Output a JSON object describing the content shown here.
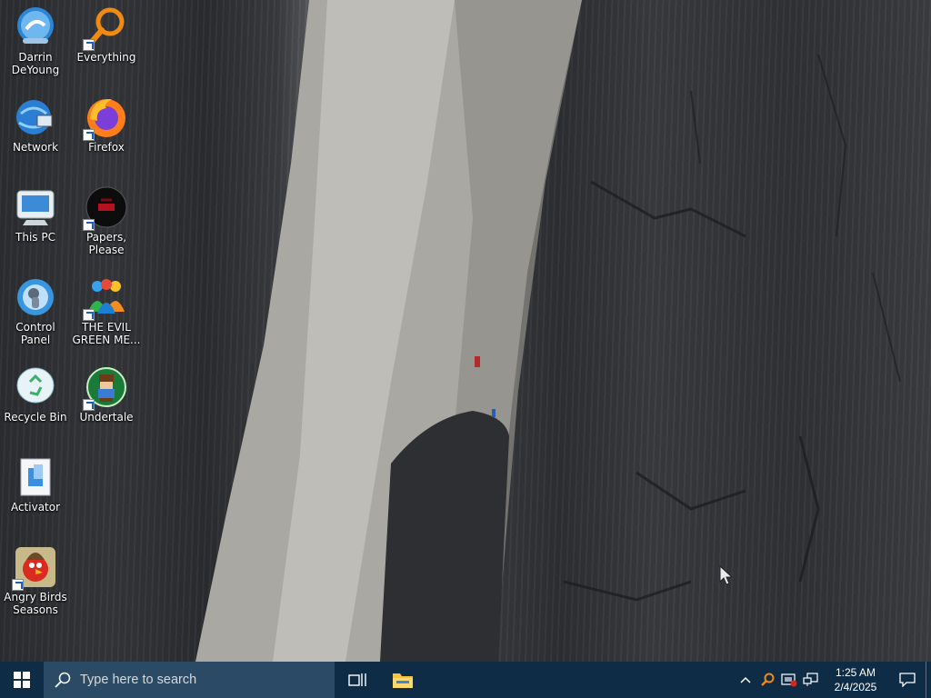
{
  "desktop": {
    "icons": [
      {
        "label": "Darrin DeYoung",
        "icon": "user-folder-icon",
        "shortcut": false
      },
      {
        "label": "Everything",
        "icon": "magnifier-orange-icon",
        "shortcut": true
      },
      {
        "label": "Network",
        "icon": "network-globe-icon",
        "shortcut": false
      },
      {
        "label": "Firefox",
        "icon": "firefox-icon",
        "shortcut": true
      },
      {
        "label": "This PC",
        "icon": "computer-icon",
        "shortcut": false
      },
      {
        "label": "Papers, Please",
        "icon": "papers-please-icon",
        "shortcut": true
      },
      {
        "label": "Control Panel",
        "icon": "control-panel-icon",
        "shortcut": false
      },
      {
        "label": "THE EVIL GREEN ME...",
        "icon": "messenger-people-icon",
        "shortcut": true
      },
      {
        "label": "Recycle Bin",
        "icon": "recycle-bin-icon",
        "shortcut": false
      },
      {
        "label": "Undertale",
        "icon": "undertale-icon",
        "shortcut": true
      },
      {
        "label": "Activator",
        "icon": "activator-file-icon",
        "shortcut": false
      },
      {
        "label": "Angry Birds Seasons",
        "icon": "angry-birds-icon",
        "shortcut": true
      }
    ]
  },
  "taskbar": {
    "search_placeholder": "Type here to search",
    "clock_time": "1:25 AM",
    "clock_date": "2/4/2025"
  },
  "colors": {
    "taskbar": "#0e2c46",
    "search_box": "#2b4a66",
    "accent": "#1b5fc1"
  }
}
